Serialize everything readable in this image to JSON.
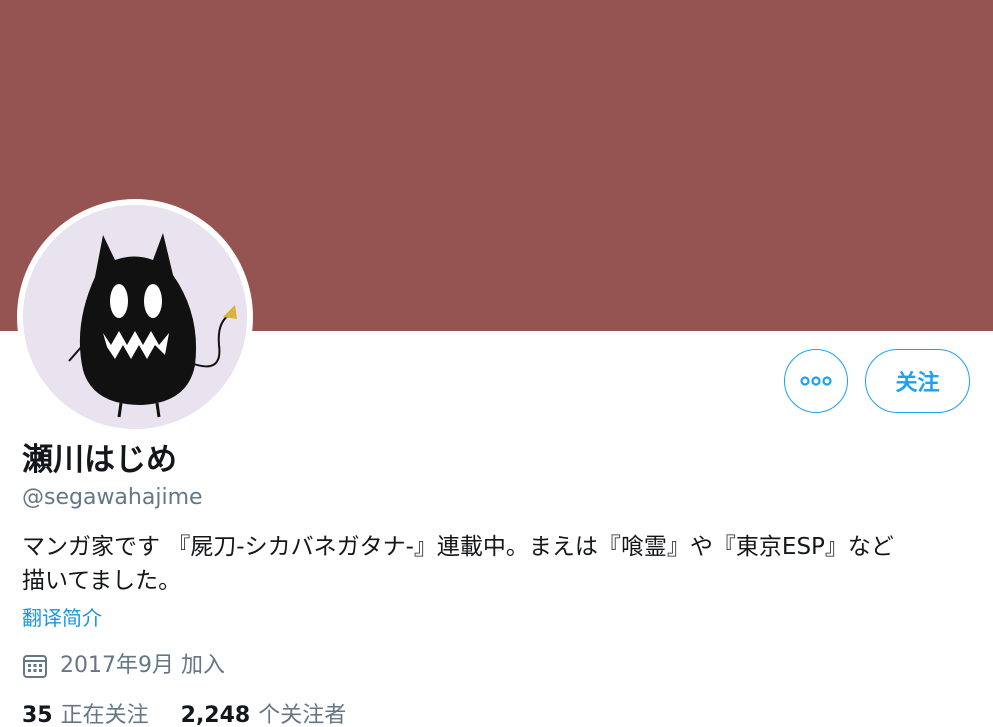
{
  "colors": {
    "banner": "#955451",
    "accent": "#1da1f2",
    "link": "#1b95e0",
    "text": "#14171a",
    "muted": "#657786"
  },
  "profile": {
    "display_name": "瀬川はじめ",
    "handle": "@segawahajime",
    "bio_lines": [
      "マンガ家です 『屍刀-シカバネガタナ-』連載中。まえは『喰霊』や『東京ESP』など",
      "描いてました。"
    ],
    "translate_label": "翻译简介",
    "joined_icon": "calendar-icon",
    "joined_label": "2017年9月 加入"
  },
  "actions": {
    "more_icon": "more-options-icon",
    "follow_label": "关注"
  },
  "stats": {
    "following_count": "35",
    "following_label": "正在关注",
    "followers_count": "2,248",
    "followers_label": "个关注者"
  }
}
